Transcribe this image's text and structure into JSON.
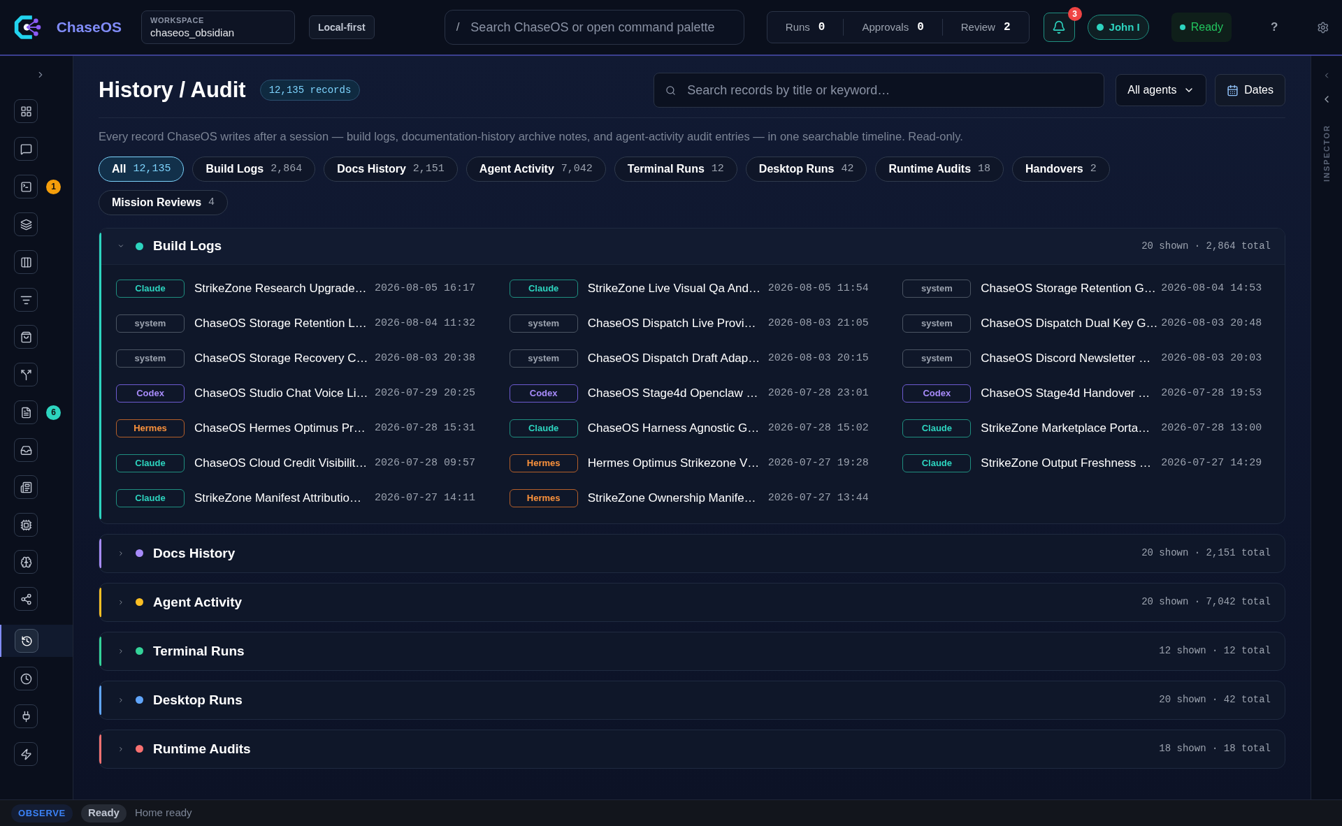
{
  "app": {
    "name": "ChaseOS",
    "workspace_label": "WORKSPACE",
    "workspace": "chaseos_obsidian",
    "mode": "Local-first"
  },
  "command": {
    "key": "/",
    "placeholder": "Search ChaseOS or open command palette"
  },
  "counters": [
    {
      "label": "Runs",
      "value": "0"
    },
    {
      "label": "Approvals",
      "value": "0"
    },
    {
      "label": "Review",
      "value": "2"
    }
  ],
  "notifications": {
    "count": "3"
  },
  "user": {
    "name": "John I",
    "online": true
  },
  "status_pill": {
    "label": "Ready"
  },
  "help": "?",
  "sidebar": {
    "items": [
      {
        "selected": false
      },
      {
        "selected": false
      },
      {
        "selected": false,
        "badge": "1",
        "color": "#f59e0b"
      },
      {
        "selected": false
      },
      {
        "selected": false
      },
      {
        "selected": false
      },
      {
        "selected": false
      },
      {
        "selected": false
      },
      {
        "selected": false,
        "badge": "6",
        "color": "#2dd4bf"
      },
      {
        "selected": false
      },
      {
        "selected": false
      },
      {
        "selected": false
      },
      {
        "selected": false
      },
      {
        "selected": false
      },
      {
        "selected": true
      },
      {
        "selected": false
      },
      {
        "selected": false
      },
      {
        "selected": false
      }
    ]
  },
  "page": {
    "title": "History / Audit",
    "records": "12,135 records",
    "search_placeholder": "Search records by title or keyword…",
    "agent_filter": "All agents",
    "dates": "Dates",
    "description": "Every record ChaseOS writes after a session — build logs, documentation-history archive notes, and agent-activity audit entries — in one searchable timeline. Read-only."
  },
  "filters": [
    {
      "label": "All",
      "count": "12,135",
      "selected": true
    },
    {
      "label": "Build Logs",
      "count": "2,864",
      "selected": false
    },
    {
      "label": "Docs History",
      "count": "2,151",
      "selected": false
    },
    {
      "label": "Agent Activity",
      "count": "7,042",
      "selected": false
    },
    {
      "label": "Terminal Runs",
      "count": "12",
      "selected": false
    },
    {
      "label": "Desktop Runs",
      "count": "42",
      "selected": false
    },
    {
      "label": "Runtime Audits",
      "count": "18",
      "selected": false
    },
    {
      "label": "Handovers",
      "count": "2",
      "selected": false
    },
    {
      "label": "Mission Reviews",
      "count": "4",
      "selected": false
    }
  ],
  "sections": [
    {
      "title": "Build Logs",
      "color": "#2dd4bf",
      "expanded": true,
      "summary": "20 shown · 2,864 total",
      "records": [
        {
          "agent": "Claude",
          "kind": "claude",
          "title": "StrikeZone Research Upgrade…",
          "time": "2026-08-05 16:17"
        },
        {
          "agent": "Claude",
          "kind": "claude",
          "title": "StrikeZone Live Visual Qa And…",
          "time": "2026-08-05 11:54"
        },
        {
          "agent": "system",
          "kind": "system",
          "title": "ChaseOS Storage Retention G…",
          "time": "2026-08-04 14:53"
        },
        {
          "agent": "system",
          "kind": "system",
          "title": "ChaseOS Storage Retention L…",
          "time": "2026-08-04 11:32"
        },
        {
          "agent": "system",
          "kind": "system",
          "title": "ChaseOS Dispatch Live Provi…",
          "time": "2026-08-03 21:05"
        },
        {
          "agent": "system",
          "kind": "system",
          "title": "ChaseOS Dispatch Dual Key G…",
          "time": "2026-08-03 20:48"
        },
        {
          "agent": "system",
          "kind": "system",
          "title": "ChaseOS Storage Recovery C…",
          "time": "2026-08-03 20:38"
        },
        {
          "agent": "system",
          "kind": "system",
          "title": "ChaseOS Dispatch Draft Adap…",
          "time": "2026-08-03 20:15"
        },
        {
          "agent": "system",
          "kind": "system",
          "title": "ChaseOS Discord Newsletter …",
          "time": "2026-08-03 20:03"
        },
        {
          "agent": "Codex",
          "kind": "codex",
          "title": "ChaseOS Studio Chat Voice Li…",
          "time": "2026-07-29 20:25"
        },
        {
          "agent": "Codex",
          "kind": "codex",
          "title": "ChaseOS Stage4d Openclaw …",
          "time": "2026-07-28 23:01"
        },
        {
          "agent": "Codex",
          "kind": "codex",
          "title": "ChaseOS Stage4d Handover …",
          "time": "2026-07-28 19:53"
        },
        {
          "agent": "Hermes",
          "kind": "hermes",
          "title": "ChaseOS Hermes Optimus Pr…",
          "time": "2026-07-28 15:31"
        },
        {
          "agent": "Claude",
          "kind": "claude",
          "title": "ChaseOS Harness Agnostic G…",
          "time": "2026-07-28 15:02"
        },
        {
          "agent": "Claude",
          "kind": "claude",
          "title": "StrikeZone Marketplace Porta…",
          "time": "2026-07-28 13:00"
        },
        {
          "agent": "Claude",
          "kind": "claude",
          "title": "ChaseOS Cloud Credit Visibilit…",
          "time": "2026-07-28 09:57"
        },
        {
          "agent": "Hermes",
          "kind": "hermes",
          "title": "Hermes Optimus Strikezone V…",
          "time": "2026-07-27 19:28"
        },
        {
          "agent": "Claude",
          "kind": "claude",
          "title": "StrikeZone Output Freshness …",
          "time": "2026-07-27 14:29"
        },
        {
          "agent": "Claude",
          "kind": "claude",
          "title": "StrikeZone Manifest Attributio…",
          "time": "2026-07-27 14:11"
        },
        {
          "agent": "Hermes",
          "kind": "hermes",
          "title": "StrikeZone Ownership Manife…",
          "time": "2026-07-27 13:44"
        }
      ]
    },
    {
      "title": "Docs History",
      "color": "#a78bfa",
      "expanded": false,
      "summary": "20 shown · 2,151 total"
    },
    {
      "title": "Agent Activity",
      "color": "#fbbf24",
      "expanded": false,
      "summary": "20 shown · 7,042 total"
    },
    {
      "title": "Terminal Runs",
      "color": "#34d399",
      "expanded": false,
      "summary": "12 shown · 12 total"
    },
    {
      "title": "Desktop Runs",
      "color": "#60a5fa",
      "expanded": false,
      "summary": "20 shown · 42 total"
    },
    {
      "title": "Runtime Audits",
      "color": "#f87171",
      "expanded": false,
      "summary": "18 shown · 18 total"
    }
  ],
  "inspector": {
    "label": "INSPECTOR"
  },
  "status_bar": {
    "mode": "OBSERVE",
    "state": "Ready",
    "message": "Home ready"
  }
}
